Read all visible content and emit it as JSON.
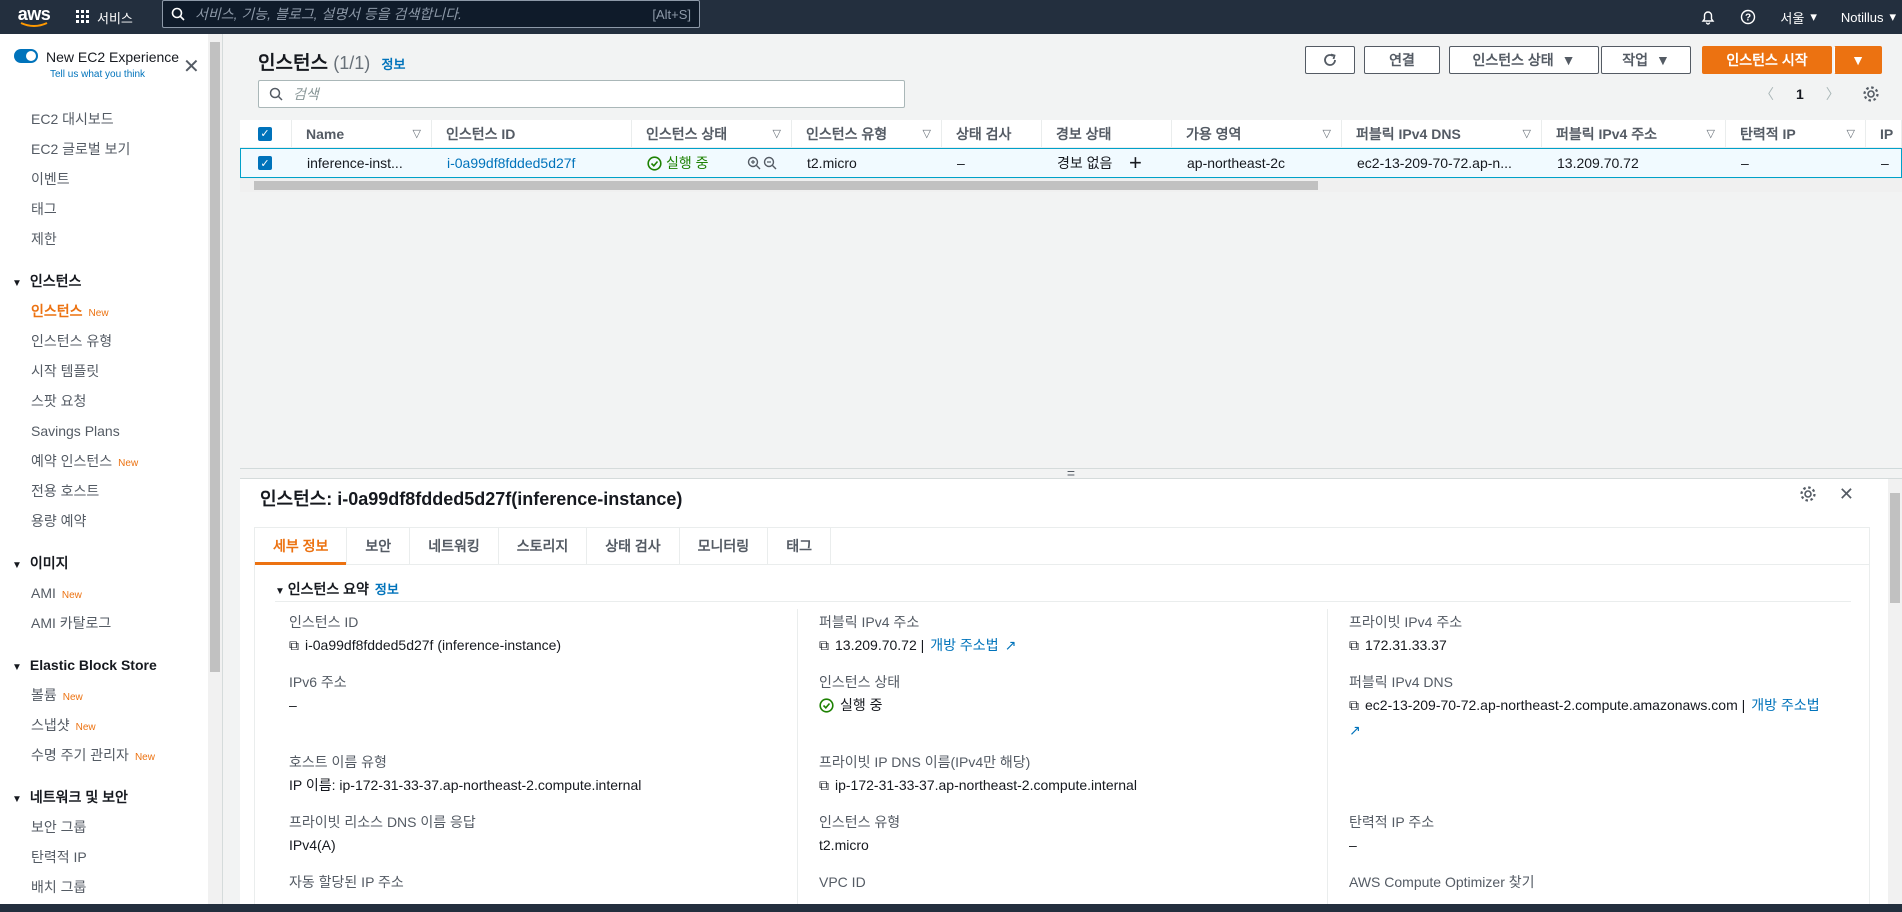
{
  "topbar": {
    "logo": "aws",
    "services": "서비스",
    "search_placeholder": "서비스, 기능, 블로그, 설명서 등을 검색합니다.",
    "search_shortcut": "[Alt+S]",
    "region": "서울",
    "account": "Notillus"
  },
  "sidebar": {
    "new_experience": "New EC2 Experience",
    "tell_us": "Tell us what you think",
    "items": [
      {
        "type": "item",
        "label": "EC2 대시보드"
      },
      {
        "type": "item",
        "label": "EC2 글로벌 보기"
      },
      {
        "type": "item",
        "label": "이벤트"
      },
      {
        "type": "item",
        "label": "태그"
      },
      {
        "type": "item",
        "label": "제한"
      },
      {
        "type": "header",
        "label": "인스턴스"
      },
      {
        "type": "item",
        "label": "인스턴스",
        "badge": "New",
        "active": true
      },
      {
        "type": "item",
        "label": "인스턴스 유형"
      },
      {
        "type": "item",
        "label": "시작 템플릿"
      },
      {
        "type": "item",
        "label": "스팟 요청"
      },
      {
        "type": "item",
        "label": "Savings Plans"
      },
      {
        "type": "item",
        "label": "예약 인스턴스",
        "badge": "New"
      },
      {
        "type": "item",
        "label": "전용 호스트"
      },
      {
        "type": "item",
        "label": "용량 예약"
      },
      {
        "type": "header",
        "label": "이미지"
      },
      {
        "type": "item",
        "label": "AMI",
        "badge": "New"
      },
      {
        "type": "item",
        "label": "AMI 카탈로그"
      },
      {
        "type": "header",
        "label": "Elastic Block Store"
      },
      {
        "type": "item",
        "label": "볼륨",
        "badge": "New"
      },
      {
        "type": "item",
        "label": "스냅샷",
        "badge": "New"
      },
      {
        "type": "item",
        "label": "수명 주기 관리자",
        "badge": "New"
      },
      {
        "type": "header",
        "label": "네트워크 및 보안"
      },
      {
        "type": "item",
        "label": "보안 그룹"
      },
      {
        "type": "item",
        "label": "탄력적 IP"
      },
      {
        "type": "item",
        "label": "배치 그룹"
      }
    ]
  },
  "instances": {
    "title": "인스턴스",
    "count": "(1/1)",
    "info": "정보",
    "filter_placeholder": "검색",
    "page": "1",
    "buttons": {
      "connect": "연결",
      "state": "인스턴스 상태",
      "actions": "작업",
      "launch": "인스턴스 시작"
    },
    "columns": [
      "Name",
      "인스턴스 ID",
      "인스턴스 상태",
      "인스턴스 유형",
      "상태 검사",
      "경보 상태",
      "가용 영역",
      "퍼블릭 IPv4 DNS",
      "퍼블릭 IPv4 주소",
      "탄력적 IP",
      "IP"
    ],
    "row": {
      "name": "inference-inst...",
      "id": "i-0a99df8fdded5d27f",
      "state": "실행 중",
      "type": "t2.micro",
      "status_check": "–",
      "alarm": "경보 없음",
      "az": "ap-northeast-2c",
      "dns": "ec2-13-209-70-72.ap-n...",
      "ipv4": "13.209.70.72",
      "eip": "–",
      "ip": "–"
    }
  },
  "detail": {
    "title": "인스턴스: i-0a99df8fdded5d27f(inference-instance)",
    "tabs": [
      "세부 정보",
      "보안",
      "네트워킹",
      "스토리지",
      "상태 검사",
      "모니터링",
      "태그"
    ],
    "section": "인스턴스 요약",
    "section_info": "정보",
    "fields": {
      "instance_id_label": "인스턴스 ID",
      "instance_id_value": "i-0a99df8fdded5d27f (inference-instance)",
      "ipv6_label": "IPv6 주소",
      "ipv6_value": "–",
      "hostname_type_label": "호스트 이름 유형",
      "hostname_type_value": "IP 이름: ip-172-31-33-37.ap-northeast-2.compute.internal",
      "private_dns_answer_label": "프라이빗 리소스 DNS 이름 응답",
      "private_dns_answer_value": "IPv4(A)",
      "auto_ip_label": "자동 할당된 IP 주소",
      "public_ipv4_label": "퍼블릭 IPv4 주소",
      "public_ipv4_value": "13.209.70.72 |",
      "open_address": "개방 주소법",
      "state_label": "인스턴스 상태",
      "state_value": "실행 중",
      "private_ip_dns_label": "프라이빗 IP DNS 이름(IPv4만 해당)",
      "private_ip_dns_value": "ip-172-31-33-37.ap-northeast-2.compute.internal",
      "instance_type_label": "인스턴스 유형",
      "instance_type_value": "t2.micro",
      "vpc_label": "VPC ID",
      "private_ipv4_label": "프라이빗 IPv4 주소",
      "private_ipv4_value": "172.31.33.37",
      "public_dns_label": "퍼블릭 IPv4 DNS",
      "public_dns_value": "ec2-13-209-70-72.ap-northeast-2.compute.amazonaws.com |",
      "open_address2": "개방 주소법",
      "eip_label": "탄력적 IP 주소",
      "eip_value": "–",
      "optimizer_label": "AWS Compute Optimizer 찾기"
    }
  }
}
